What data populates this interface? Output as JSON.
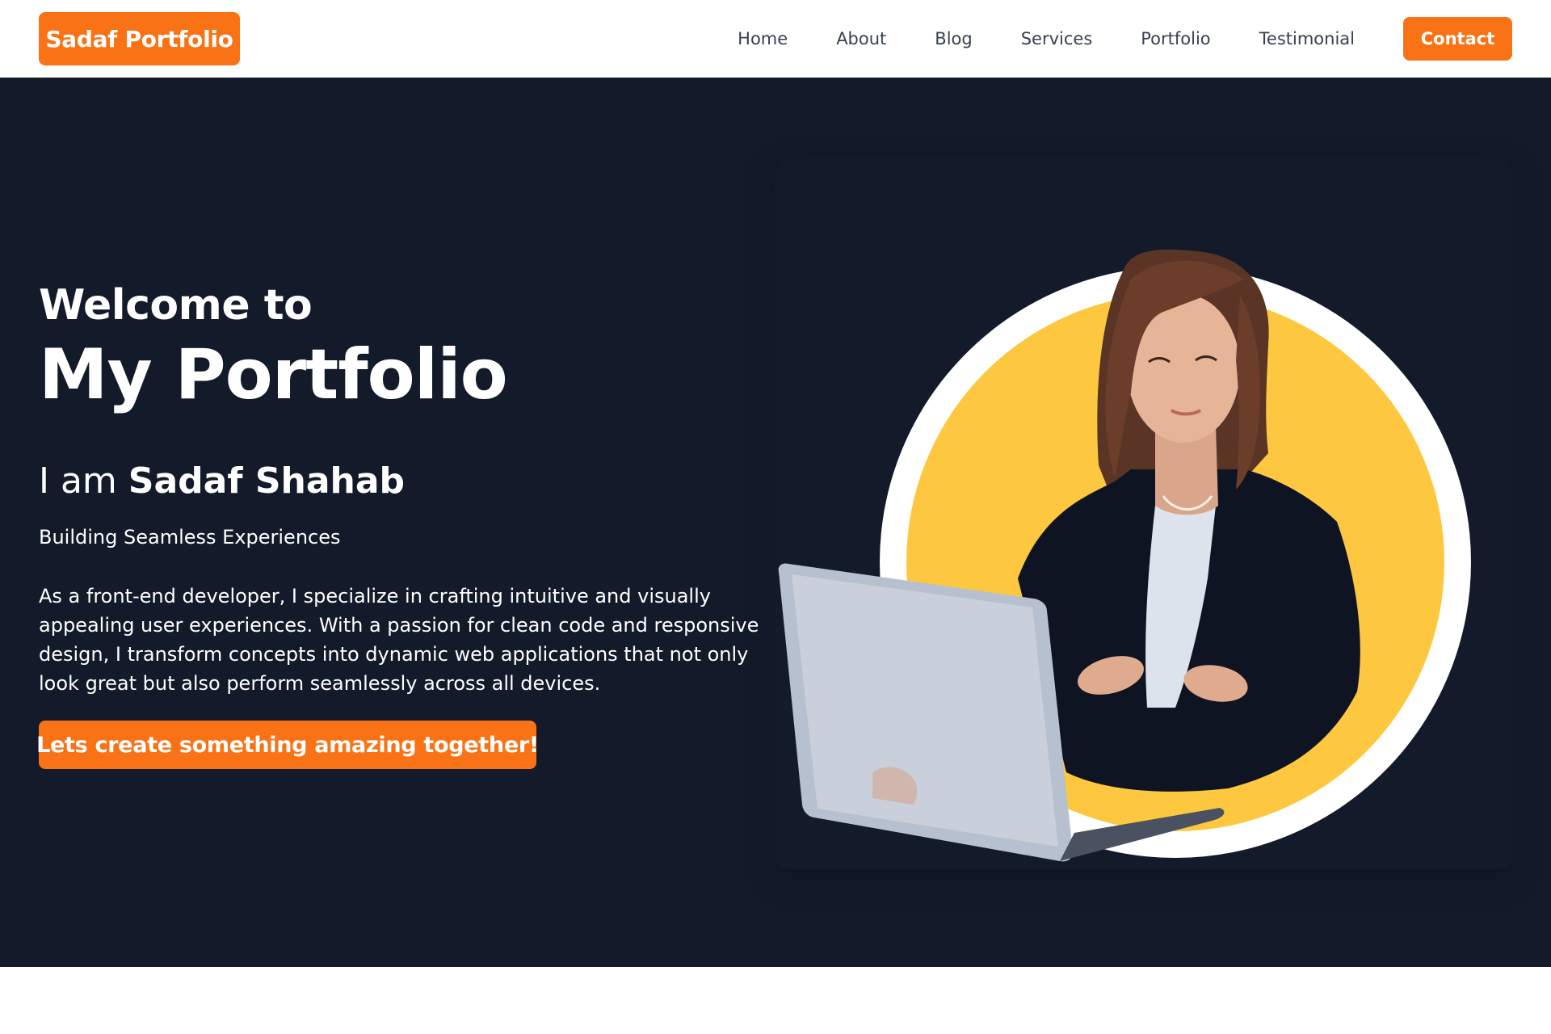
{
  "navbar": {
    "logo": "Sadaf Portfolio",
    "links": [
      "Home",
      "About",
      "Blog",
      "Services",
      "Portfolio",
      "Testimonial"
    ],
    "contact_label": "Contact"
  },
  "hero": {
    "welcome": "Welcome to",
    "title": "My Portfolio",
    "intro_prefix": "I am",
    "name": "Sadaf Shahab",
    "tagline": "Building Seamless Experiences",
    "description": "As a front-end developer, I specialize in crafting intuitive and visually appealing user experiences. With a passion for clean code and responsive design, I transform concepts into dynamic web applications that not only look great but also perform seamlessly across all devices.",
    "cta_label": "Lets create something amazing together!"
  },
  "colors": {
    "accent": "#f97316",
    "hero_background": "#131a2a",
    "circle_fill": "#fdc83f",
    "text_light": "#ffffff",
    "nav_text": "#374151"
  }
}
